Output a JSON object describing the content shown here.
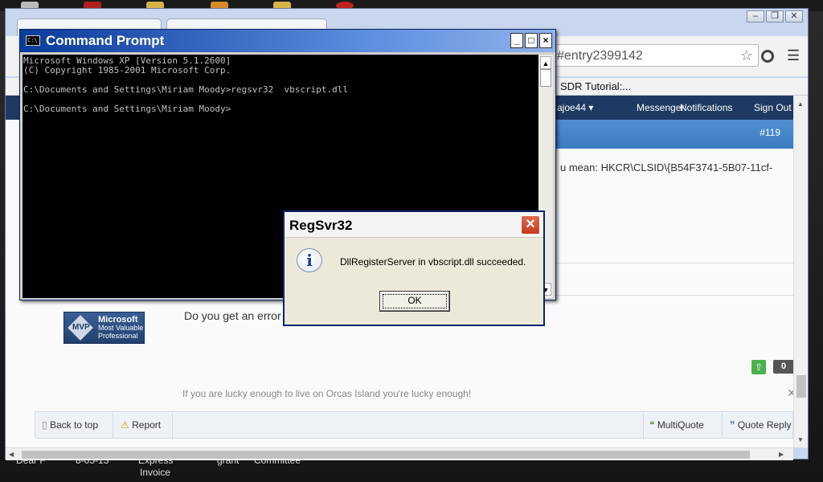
{
  "desktop": {
    "labels": [
      "Dear F",
      "8-05-13",
      "Express",
      "Invoice",
      "grant",
      "Committee"
    ]
  },
  "browser": {
    "omnibox": "#entry2399142",
    "bookmark": "SDR Tutorial:...",
    "nav": {
      "user": "ajoe44",
      "messenger": "Messenger",
      "notifications": "Notifications",
      "signout": "Sign Out"
    },
    "post": {
      "number": "#119",
      "text": "u mean: HKCR\\CLSID\\{B54F3741-5B07-11cf-",
      "body": "Do you get an error",
      "votes": "0",
      "signature": "If you are lucky enough to live on Orcas Island you're lucky enough!"
    },
    "mvp": {
      "badge": "MVP",
      "line1": "Microsoft",
      "line2": "Most Valuable",
      "line3": "Professional"
    },
    "footer": {
      "back_to_top": "Back to top",
      "report": "Report",
      "multiquote": "MultiQuote",
      "quote_reply": "Quote Reply"
    }
  },
  "cmd": {
    "title": "Command Prompt",
    "lines": [
      "Microsoft Windows XP [Version 5.1.2600]",
      "(C) Copyright 1985-2001 Microsoft Corp.",
      "",
      "C:\\Documents and Settings\\Miriam Moody>regsvr32  vbscript.dll",
      "",
      "C:\\Documents and Settings\\Miriam Moody>"
    ]
  },
  "dialog": {
    "title": "RegSvr32",
    "message": "DllRegisterServer in vbscript.dll succeeded.",
    "ok_label": "OK"
  }
}
